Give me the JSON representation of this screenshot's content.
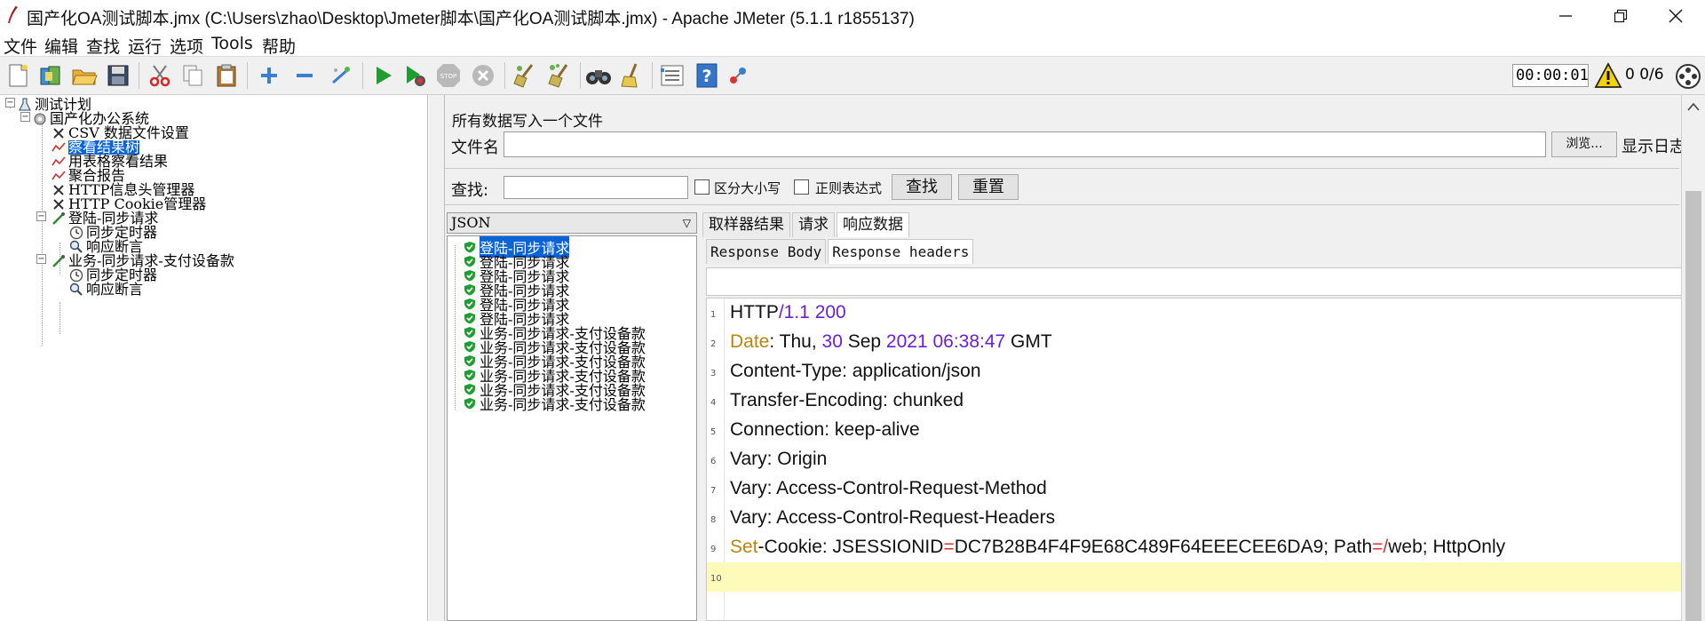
{
  "window": {
    "title": "国产化OA测试脚本.jmx (C:\\Users\\zhao\\Desktop\\Jmeter脚本\\国产化OA测试脚本.jmx) - Apache JMeter (5.1.1 r1855137)"
  },
  "menu": [
    "文件",
    "编辑",
    "查找",
    "运行",
    "选项",
    "Tools",
    "帮助"
  ],
  "toolbar": {
    "timer": "00:00:01",
    "threads": "0 0/6"
  },
  "tree": {
    "nodes": [
      {
        "label": "测试计划",
        "icon": "flask-icon"
      },
      {
        "label": "国产化办公系统",
        "icon": "gear-icon"
      },
      {
        "label": "CSV 数据文件设置",
        "icon": "scissors-icon"
      },
      {
        "label": "察看结果树",
        "icon": "graph-icon",
        "selected": true
      },
      {
        "label": "用表格察看结果",
        "icon": "graph-icon"
      },
      {
        "label": "聚合报告",
        "icon": "graph-icon"
      },
      {
        "label": "HTTP信息头管理器",
        "icon": "scissors-icon"
      },
      {
        "label": "HTTP Cookie管理器",
        "icon": "scissors-icon"
      },
      {
        "label": "登陆-同步请求",
        "icon": "pipette-icon"
      },
      {
        "label": "同步定时器",
        "icon": "timer-icon"
      },
      {
        "label": "响应断言",
        "icon": "magnifier-icon"
      },
      {
        "label": "业务-同步请求-支付设备款",
        "icon": "pipette-icon"
      },
      {
        "label": "同步定时器",
        "icon": "timer-icon"
      },
      {
        "label": "响应断言",
        "icon": "magnifier-icon"
      }
    ]
  },
  "file_section": {
    "group_title": "所有数据写入一个文件",
    "file_label": "文件名",
    "browse_label": "浏览...",
    "log_label": "显示日志"
  },
  "search": {
    "label": "查找:",
    "case_label": "区分大小写",
    "regex_label": "正则表达式",
    "find_label": "查找",
    "reset_label": "重置"
  },
  "results": {
    "renderer": "JSON",
    "samples": [
      {
        "label": "登陆-同步请求",
        "selected": true
      },
      {
        "label": "登陆-同步请求"
      },
      {
        "label": "登陆-同步请求"
      },
      {
        "label": "登陆-同步请求"
      },
      {
        "label": "登陆-同步请求"
      },
      {
        "label": "登陆-同步请求"
      },
      {
        "label": "业务-同步请求-支付设备款"
      },
      {
        "label": "业务-同步请求-支付设备款"
      },
      {
        "label": "业务-同步请求-支付设备款"
      },
      {
        "label": "业务-同步请求-支付设备款"
      },
      {
        "label": "业务-同步请求-支付设备款"
      },
      {
        "label": "业务-同步请求-支付设备款"
      }
    ]
  },
  "detail": {
    "tabs": [
      "取样器结果",
      "请求",
      "响应数据"
    ],
    "active_tab": 2,
    "subtabs": [
      "Response Body",
      "Response headers"
    ],
    "active_subtab": 1,
    "lines": [
      {
        "num": "1",
        "parts": [
          [
            "HTTP",
            ""
          ],
          [
            "/",
            "k-purple"
          ],
          [
            "1.1 200",
            "k-purple"
          ]
        ]
      },
      {
        "num": "2",
        "parts": [
          [
            "Date",
            "k-orange"
          ],
          [
            ": Thu, ",
            ""
          ],
          [
            "30",
            "k-purple"
          ],
          [
            " Sep ",
            ""
          ],
          [
            "2021 06:38:47",
            "k-purple"
          ],
          [
            " GMT",
            ""
          ]
        ]
      },
      {
        "num": "3",
        "parts": [
          [
            "Content-Type: application/json",
            ""
          ]
        ]
      },
      {
        "num": "4",
        "parts": [
          [
            "Transfer-Encoding: chunked",
            ""
          ]
        ]
      },
      {
        "num": "5",
        "parts": [
          [
            "Connection: keep-alive",
            ""
          ]
        ]
      },
      {
        "num": "6",
        "parts": [
          [
            "Vary: Origin",
            ""
          ]
        ]
      },
      {
        "num": "7",
        "parts": [
          [
            "Vary: Access-Control-Request-Method",
            ""
          ]
        ]
      },
      {
        "num": "8",
        "parts": [
          [
            "Vary: Access-Control-Request-Headers",
            ""
          ]
        ]
      },
      {
        "num": "9",
        "parts": [
          [
            "Set",
            "k-orange"
          ],
          [
            "-Cookie: JSESSIONID",
            ""
          ],
          [
            "=",
            "k-red"
          ],
          [
            "DC7B28B4F4F9E68C489F64EEECEE6DA9; Path",
            ""
          ],
          [
            "=/",
            "k-red"
          ],
          [
            "web; HttpOnly",
            ""
          ]
        ]
      },
      {
        "num": "10",
        "parts": [
          [
            "",
            ""
          ]
        ],
        "current": true
      }
    ]
  },
  "colors": {
    "selection": "#0a64d8",
    "current_line": "#fefab9",
    "keyword_orange": "#b8860b",
    "number_purple": "#6a1ed8"
  }
}
